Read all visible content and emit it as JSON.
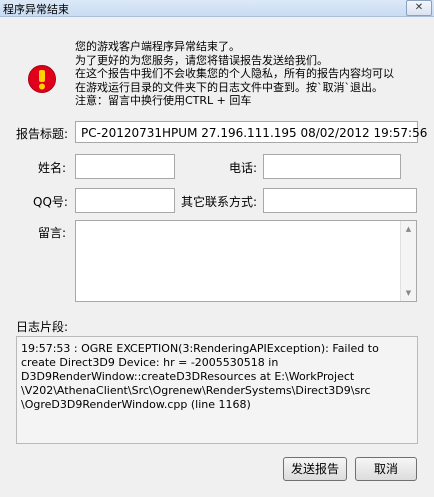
{
  "window": {
    "title": "程序异常结束",
    "close_glyph": "✕"
  },
  "icon": {
    "name": "error-icon",
    "color": "#e0001b",
    "dot_color": "#ffd200"
  },
  "message": [
    "您的游戏客户端程序异常结束了。",
    "为了更好的为您服务，请您将错误报告发送给我们。",
    "在这个报告中我们不会收集您的个人隐私，所有的报告内容均可以",
    "在游戏运行目录的文件夹下的日志文件中查到。按`取消`退出。",
    "注意：留言中换行使用CTRL + 回车"
  ],
  "form": {
    "report_title_label": "报告标题:",
    "report_title_value": "PC-20120731HPUM  27.196.111.195  08/02/2012 19:57:56",
    "name_label": "姓名:",
    "name_value": "",
    "phone_label": "电话:",
    "phone_value": "",
    "qq_label": "QQ号:",
    "qq_value": "",
    "other_contact_label": "其它联系方式:",
    "other_contact_value": "",
    "message_label": "留言:",
    "message_value": ""
  },
  "log": {
    "label": "日志片段:",
    "text": "19:57:53 : OGRE EXCEPTION(3:RenderingAPIException): Failed to\ncreate Direct3D9 Device: hr = -2005530518 in\nD3D9RenderWindow::createD3DResources at E:\\WorkProject\n\\V202\\AthenaClient\\Src\\Ogrenew\\RenderSystems\\Direct3D9\\src\n\\OgreD3D9RenderWindow.cpp (line 1168)"
  },
  "buttons": {
    "send": "发送报告",
    "cancel": "取消"
  }
}
